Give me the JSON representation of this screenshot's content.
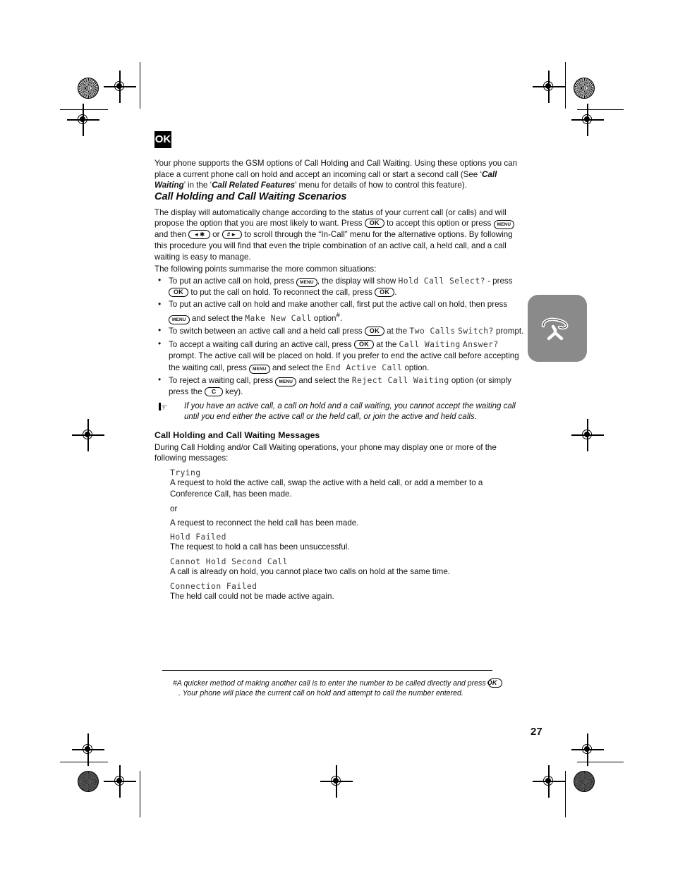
{
  "page": {
    "number": "27",
    "logo_label": "OK"
  },
  "intro": {
    "text_1": "Your phone supports the GSM options of Call Holding and Call Waiting. Using these options you can place a current phone call on hold and accept an incoming call or start a second call (See ‘",
    "em_1": "Call Waiting",
    "text_2": "’ in the ‘",
    "em_2": "Call Related Features",
    "text_3": "’ menu for details of how to control this feature)."
  },
  "section": {
    "heading": "Call Holding and Call Waiting Scenarios",
    "para_a1": "The display will automatically change according to the status of your current call (or calls) and will propose the option that you are most likely to want. Press",
    "para_a2": "to accept this option or press",
    "para_a3": "and then",
    "para_a4": "or",
    "para_a5": "to scroll through the “In-Call” menu for the alternative options. By following this procedure you will find that even the triple combination of an active call, a held call, and a call waiting is easy to manage.",
    "para_b": "The following points summarise the more common situations:"
  },
  "keys": {
    "ok": "OK",
    "menu": "MENU",
    "clear": "C",
    "star": "◄✱",
    "hash": "#►"
  },
  "bullets": {
    "b1_p1": "To put an active call on hold, press",
    "b1_p2": ", the display will show",
    "b1_mono": "Hold Call Select?",
    "b1_p3": "- press",
    "b1_p4": "to put the call on hold. To reconnect the call, press",
    "b1_p5": ".",
    "b2_p1": "To put an active call on hold and make another call, first put the active call on hold, then press",
    "b2_p2": "and select the",
    "b2_mono": "Make New Call",
    "b2_p3": "option",
    "b2_sup": "#",
    "b2_p4": ".",
    "b3_p1": "To switch between an active call and a held call press",
    "b3_p2": "at the",
    "b3_mono_a": "Two Calls",
    "b3_mono_b": "Switch?",
    "b3_p3": "prompt.",
    "b4_p1": "To accept a waiting call during an active call, press",
    "b4_p2": "at the",
    "b4_mono_a": "Call Waiting",
    "b4_mono_b": "Answer?",
    "b4_p3": "prompt. The active call will be placed on hold. If you prefer to end the active call before accepting the waiting call, press",
    "b4_p4": "and select the",
    "b4_mono_c": "End Active Call",
    "b4_p5": "option.",
    "b5_p1": "To reject a waiting call, press",
    "b5_p2": "and select the",
    "b5_mono": "Reject Call Waiting",
    "b5_p3": "option (or simply press the",
    "b5_p4": "key)."
  },
  "note": {
    "icon": "pointing-hand-icon",
    "text": "If you have an active call, a call on hold and a call waiting, you cannot accept the waiting call until you end either the active call or the held call, or join the active and held calls."
  },
  "messages": {
    "heading": "Call Holding and Call Waiting Messages",
    "intro": "During Call Holding and/or Call Waiting operations, your phone may display one or more of the following messages:",
    "items": [
      {
        "term": "Trying",
        "desc": "A request to hold the active call, swap the active with a held call, or add a member to a Conference Call, has been made.",
        "or": "or",
        "desc2": "A request to reconnect the held call has been made."
      },
      {
        "term": "Hold Failed",
        "desc": "The request to hold a call has been unsuccessful."
      },
      {
        "term": "Cannot Hold Second Call",
        "desc": "A call is already on hold, you cannot place two calls on hold at the same time."
      },
      {
        "term": "Connection Failed",
        "desc": "The held call could not be made active again."
      }
    ]
  },
  "footnote": {
    "marker": "#",
    "part_1": "A quicker method of making another call is to enter the number to be called directly and press",
    "part_2": ". Your phone will place the current call on hold and attempt to call the number entered."
  },
  "sidetab": {
    "icon": "phone-handset-icon",
    "color": "#8a8a8a"
  }
}
